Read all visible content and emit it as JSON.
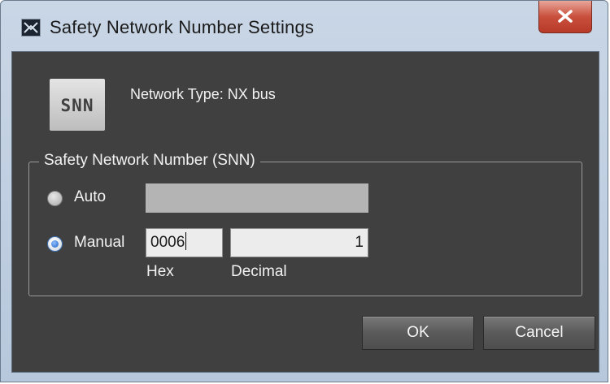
{
  "window": {
    "title": "Safety Network Number Settings",
    "app_icon": "snn-window-icon",
    "close_icon": "close-icon"
  },
  "header": {
    "logo_text": "SNN",
    "network_type": "Network Type: NX bus"
  },
  "snn_group": {
    "legend": "Safety Network Number (SNN)",
    "auto": {
      "label": "Auto",
      "selected": false,
      "value": ""
    },
    "manual": {
      "label": "Manual",
      "selected": true,
      "hex_value": "0006",
      "decimal_value": "1",
      "hex_label": "Hex",
      "decimal_label": "Decimal"
    }
  },
  "buttons": {
    "ok": "OK",
    "cancel": "Cancel"
  },
  "colors": {
    "client_background": "#404040",
    "title_bar": "#c3d2e3",
    "close_button": "#c9503d",
    "radio_selected": "#1f5fc0"
  }
}
